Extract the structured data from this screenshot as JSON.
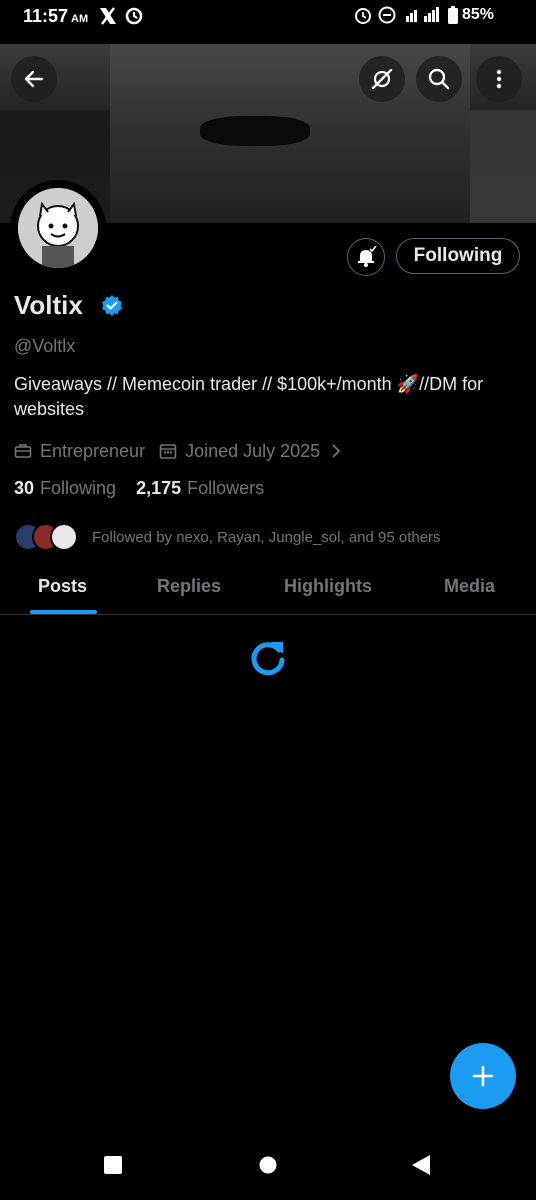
{
  "status_bar": {
    "time": "11:57",
    "ampm": "AM",
    "battery": "85%"
  },
  "profile": {
    "display_name": "Voltix",
    "handle": "@Voltlx",
    "bio": "Giveaways // Memecoin trader // $100k+/month 🚀//DM for websites",
    "category": "Entrepreneur",
    "joined": "Joined July 2025",
    "following_count": "30",
    "following_label": "Following",
    "followers_count": "2,175",
    "followers_label": "Followers",
    "followed_by": "Followed by nexo, Rayan, Jungle_sol, and 95 others"
  },
  "actions": {
    "follow_state": "Following"
  },
  "tabs": [
    {
      "label": "Posts"
    },
    {
      "label": "Replies"
    },
    {
      "label": "Highlights"
    },
    {
      "label": "Media"
    }
  ],
  "colors": {
    "accent": "#1d9bf0",
    "background": "#000000",
    "muted": "#71767b"
  }
}
